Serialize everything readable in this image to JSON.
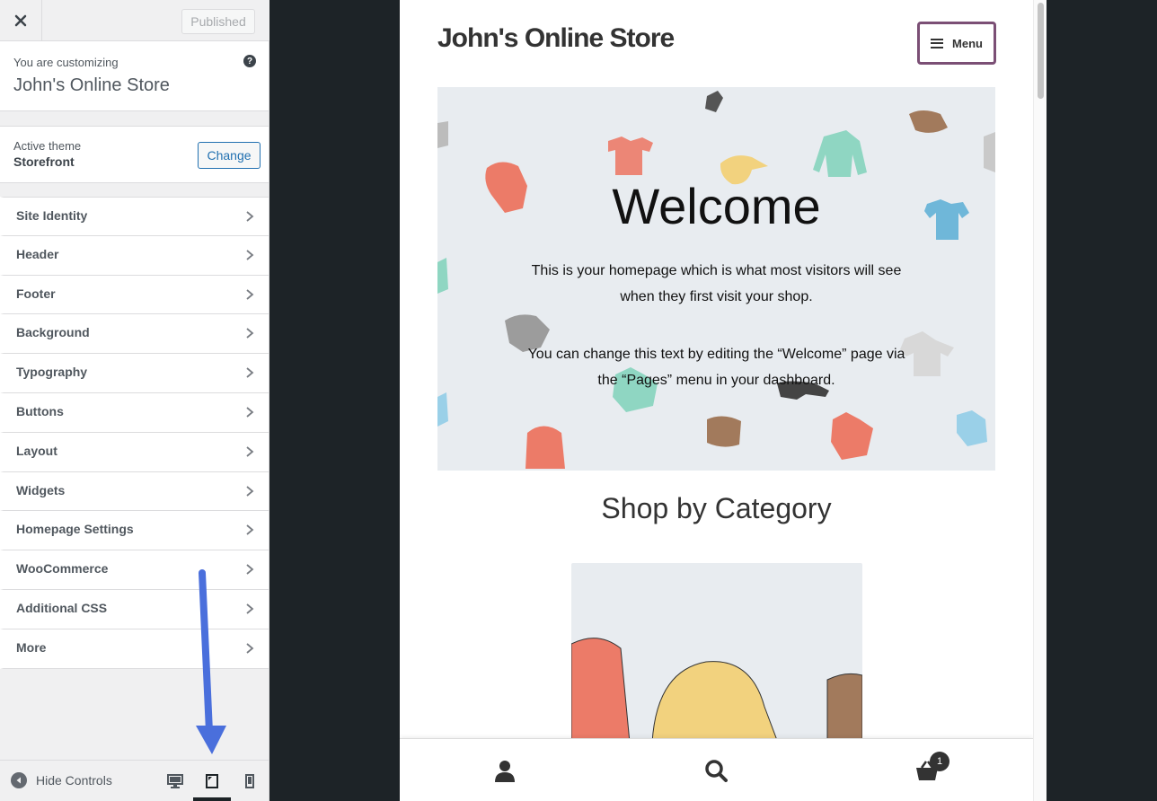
{
  "topbar": {
    "published_label": "Published"
  },
  "info": {
    "customizing_label": "You are customizing",
    "site_name": "John's Online Store"
  },
  "theme": {
    "active_label": "Active theme",
    "name": "Storefront",
    "change_label": "Change"
  },
  "sections": [
    {
      "label": "Site Identity"
    },
    {
      "label": "Header"
    },
    {
      "label": "Footer"
    },
    {
      "label": "Background"
    },
    {
      "label": "Typography"
    },
    {
      "label": "Buttons"
    },
    {
      "label": "Layout"
    },
    {
      "label": "Widgets"
    },
    {
      "label": "Homepage Settings"
    },
    {
      "label": "WooCommerce"
    },
    {
      "label": "Additional CSS"
    },
    {
      "label": "More"
    }
  ],
  "footer": {
    "hide_controls_label": "Hide Controls",
    "devices": [
      "desktop-icon",
      "tablet-icon",
      "mobile-icon"
    ],
    "selected_device": "tablet"
  },
  "annotation": {
    "arrow_color": "#4a6fdc"
  },
  "preview": {
    "site_title": "John's Online Store",
    "menu_label": "Menu",
    "hero": {
      "title": "Welcome",
      "paragraph1": "This is your homepage which is what most visitors will see when they first visit your shop.",
      "paragraph2": "You can change this text by editing the “Welcome” page via the “Pages” menu in your dashboard."
    },
    "shop_heading": "Shop by Category",
    "cart_count": "1",
    "menu_border_color": "#7b4f75"
  }
}
